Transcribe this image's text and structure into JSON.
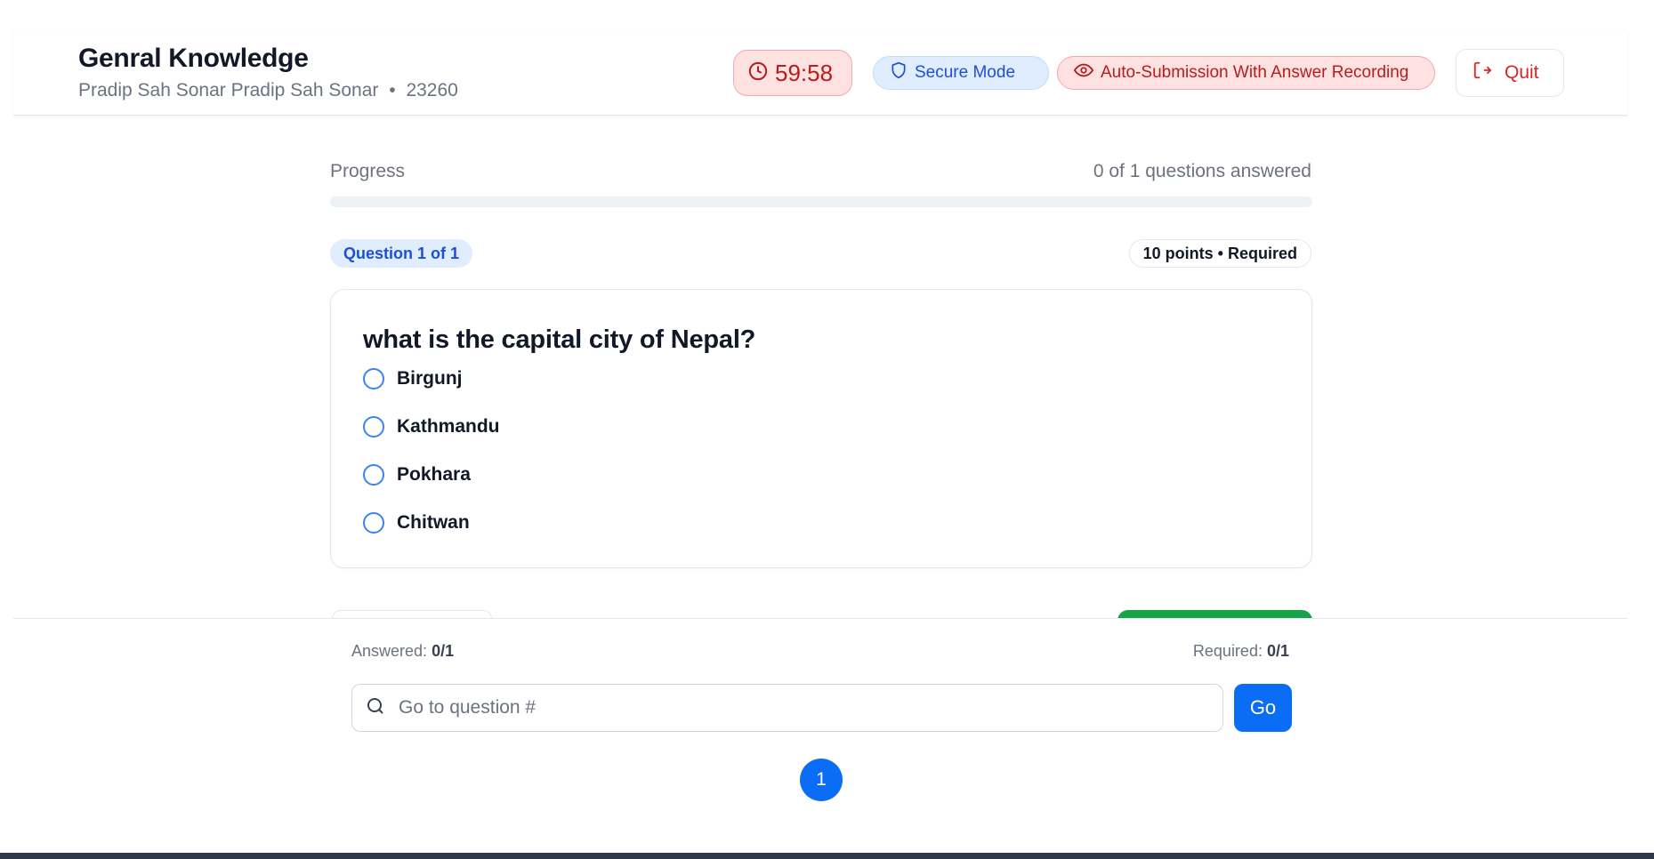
{
  "header": {
    "title": "Genral Knowledge",
    "student_name": "Pradip Sah Sonar Pradip Sah Sonar",
    "separator": "•",
    "student_id": "23260",
    "timer": "59:58",
    "secure_mode_label": "Secure Mode",
    "auto_submission_label": "Auto-Submission With Answer Recording",
    "quit_label": "Quit"
  },
  "progress": {
    "label": "Progress",
    "count_text": "0 of 1 questions answered",
    "fraction": 0
  },
  "question": {
    "badge": "Question 1 of 1",
    "points": "10 points • Required",
    "text": "what is the capital city of Nepal?",
    "options": [
      "Birgunj",
      "Kathmandu",
      "Pokhara",
      "Chitwan"
    ]
  },
  "footer": {
    "answered_label": "Answered:",
    "answered_value": "0/1",
    "required_label": "Required:",
    "required_value": "0/1",
    "search_placeholder": "Go to question #",
    "go_label": "Go",
    "pages": [
      "1"
    ]
  },
  "colors": {
    "primary": "#0b6cf5",
    "danger": "#dc2626",
    "success": "#16a34a"
  }
}
